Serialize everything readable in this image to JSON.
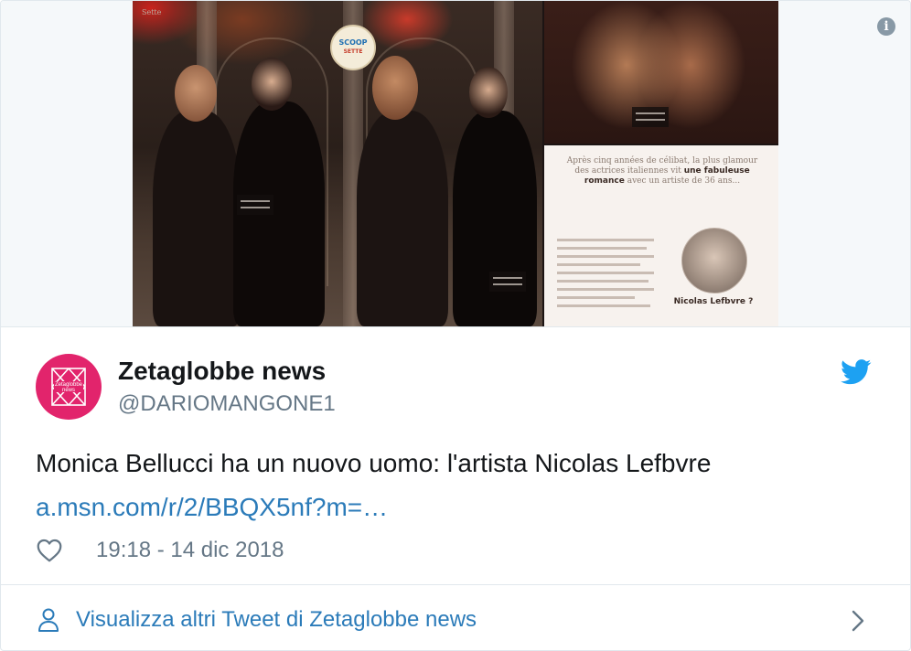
{
  "media": {
    "corner_text": "Sette",
    "scoop_badge": {
      "top": "SCOOP",
      "bottom": "SETTE"
    },
    "headline": {
      "lead": "Après cinq années de célibat, la plus glamour des actrices italiennes vit",
      "bold": "une fabuleuse romance",
      "tail": "avec un artiste de 36 ans..."
    },
    "caption_name": "Nicolas Lefbvre ?"
  },
  "author": {
    "avatar_text": "Zetaglobbe news",
    "name": "Zetaglobbe news",
    "handle": "@DARIOMANGONE1"
  },
  "tweet": {
    "text": "Monica Bellucci ha un nuovo uomo: l'artista Nicolas Lefbvre",
    "link": "a.msn.com/r/2/BBQX5nf?m=…",
    "timestamp": "19:18 - 14 dic 2018"
  },
  "footer": {
    "label": "Visualizza altri Tweet di Zetaglobbe news"
  },
  "icons": {
    "info": "info-icon",
    "twitter": "twitter-bird-icon",
    "like": "heart-icon",
    "person": "person-icon",
    "chevron": "chevron-right-icon"
  },
  "colors": {
    "brand_blue": "#1da1f2",
    "link_blue": "#2b7bb9",
    "avatar_pink": "#e2246c",
    "secondary_text": "#657786",
    "primary_text": "#14171a"
  }
}
